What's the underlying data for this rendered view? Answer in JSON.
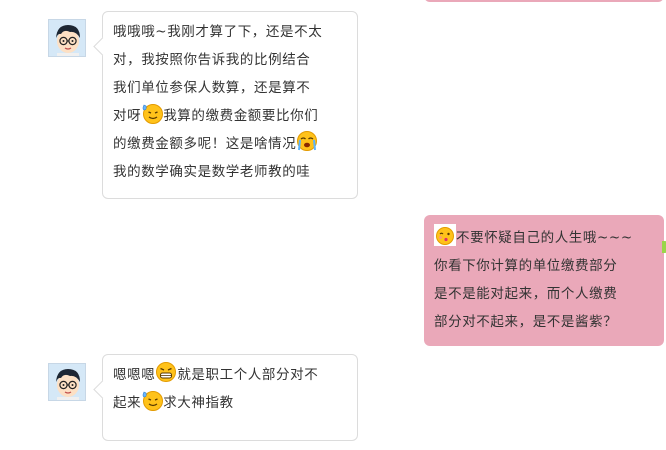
{
  "messages": [
    {
      "id": "msg1",
      "sender": "incoming",
      "lines": [
        {
          "text": "哦哦哦~我刚才算了下，还是不太"
        },
        {
          "text": "对，我按照你告诉我的比例结合"
        },
        {
          "text": "我们单位参保人数算，还是算不"
        },
        {
          "pre": "对呀",
          "emoji": "sweat-smile-emoji",
          "post": "我算的缴费金额要比你们"
        },
        {
          "pre": "的缴费金额多呢！这是啥情况",
          "emoji": "crying-emoji",
          "post": ""
        },
        {
          "text": "我的数学确实是数学老师教的哇"
        }
      ]
    },
    {
      "id": "msg2",
      "sender": "outgoing",
      "lines": [
        {
          "pre": "",
          "emoji": "kiss-emoji",
          "post": "不要怀疑自己的人生哦~~~"
        },
        {
          "text": "你看下你计算的单位缴费部分"
        },
        {
          "text": "是不是能对起来，而个人缴费"
        },
        {
          "text": "部分对不起来，是不是酱紫？"
        }
      ]
    },
    {
      "id": "msg3",
      "sender": "incoming",
      "lines": [
        {
          "pre": "嗯嗯嗯",
          "emoji": "grimace-emoji",
          "post": "就是职工个人部分对不"
        },
        {
          "pre": "起来",
          "emoji": "sweat-smile-emoji",
          "post": "求大神指教"
        }
      ]
    }
  ],
  "colors": {
    "outgoing_bubble": "#eaa8b9",
    "incoming_bubble": "#ffffff",
    "bubble_border": "#dcdcdc",
    "accent_green": "#9ad64a"
  }
}
